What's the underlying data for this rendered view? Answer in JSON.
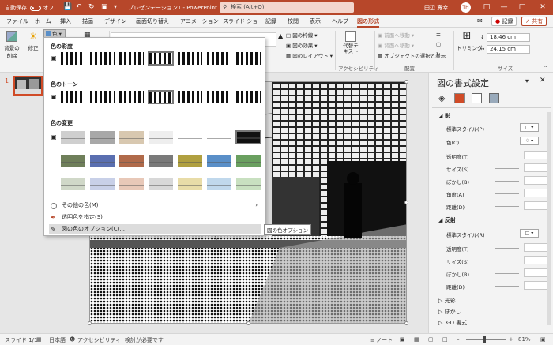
{
  "titlebar": {
    "autosave_label": "自動保存",
    "autosave_state": "オフ",
    "doc_title": "プレゼンテーション1 - PowerPoint",
    "search_placeholder": "検索 (Alt+Q)",
    "user_name": "田辺 寛幸",
    "avatar_initials": "TH",
    "accent_color": "#b7472a"
  },
  "tabs": [
    "ファイル",
    "ホーム",
    "挿入",
    "描画",
    "デザイン",
    "画面切り替え",
    "アニメーション",
    "スライド ショー",
    "記録",
    "校閲",
    "表示",
    "ヘルプ",
    "図の形式"
  ],
  "active_tab": "図の形式",
  "tab_buttons": {
    "record": "記録",
    "share": "共有"
  },
  "ribbon": {
    "remove_bg": "背景の\n削除",
    "corrections": "修正",
    "color": "色",
    "border": "図の枠線",
    "effects": "図の効果",
    "layout": "図のレイアウト",
    "alt_text": "代替テキスト",
    "accessibility_group": "アクセシビリティ",
    "bring_forward": "前面へ移動",
    "send_backward": "背面へ移動",
    "selection_pane": "オブジェクトの選択と表示",
    "arrange_group": "配置",
    "crop": "トリミング",
    "height": "18.46 cm",
    "width": "24.15 cm",
    "size_group": "サイズ"
  },
  "color_menu": {
    "saturation_header": "色の彩度",
    "tone_header": "色のトーン",
    "recolor_header": "色の変更",
    "more_colors": "その他の色(M)",
    "set_transparent": "透明色を指定(S)",
    "color_options": "図の色のオプション(C)..."
  },
  "tooltip": "図の色オプション",
  "slide_number": "1",
  "pane": {
    "title": "図の書式設定",
    "shadow_section": "影",
    "shadow_rows": [
      "標準スタイル(P)",
      "色(C)",
      "透明度(T)",
      "サイズ(S)",
      "ぼかし(B)",
      "角度(A)",
      "距離(D)"
    ],
    "reflection_section": "反射",
    "reflection_rows": [
      "標準スタイル(R)",
      "透明度(T)",
      "サイズ(S)",
      "ぼかし(B)",
      "距離(D)"
    ],
    "glow_section": "光彩",
    "soft_edges_section": "ぼかし",
    "threed_section": "3-D 書式"
  },
  "status": {
    "slide": "スライド 1/1",
    "language": "日本語",
    "accessibility": "アクセシビリティ: 検討が必要です",
    "notes": "ノート",
    "zoom": "81%"
  }
}
